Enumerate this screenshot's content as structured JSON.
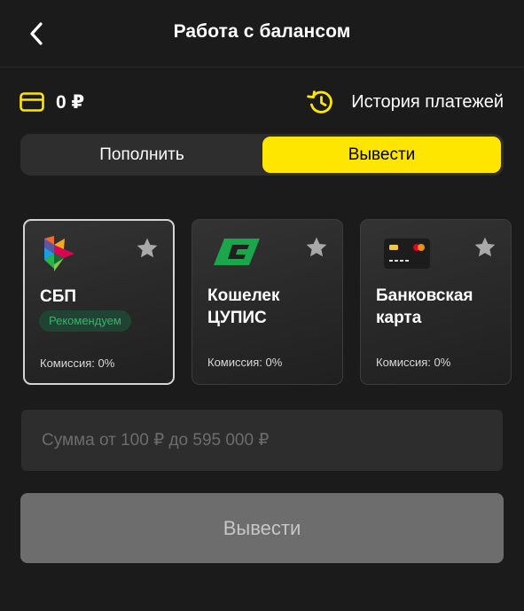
{
  "header": {
    "title": "Работа с балансом",
    "back_icon": "chevron-left-icon"
  },
  "balance": {
    "amount": "0 ₽",
    "icon": "card-icon",
    "accent": "#ffe600"
  },
  "history": {
    "label": "История платежей",
    "icon": "history-icon"
  },
  "tabs": [
    {
      "label": "Пополнить",
      "active": false
    },
    {
      "label": "Вывести",
      "active": true
    }
  ],
  "methods": [
    {
      "title": "СБП",
      "badge": "Рекомендуем",
      "commission": "Комиссия: 0%",
      "icon": "sbp-logo-icon",
      "selected": true
    },
    {
      "title": "Кошелек ЦУПИС",
      "commission": "Комиссия: 0%",
      "icon": "cupis-logo-icon",
      "selected": false
    },
    {
      "title": "Банковская карта",
      "commission": "Комиссия: 0%",
      "icon": "bank-card-icon",
      "selected": false
    }
  ],
  "amount": {
    "value": "",
    "placeholder": "Сумма от 100 ₽ до 595 000 ₽"
  },
  "submit": {
    "label": "Вывести",
    "disabled": true
  },
  "colors": {
    "background": "#1b1b1b",
    "accent": "#ffe600",
    "recommend": "#34b56a"
  }
}
